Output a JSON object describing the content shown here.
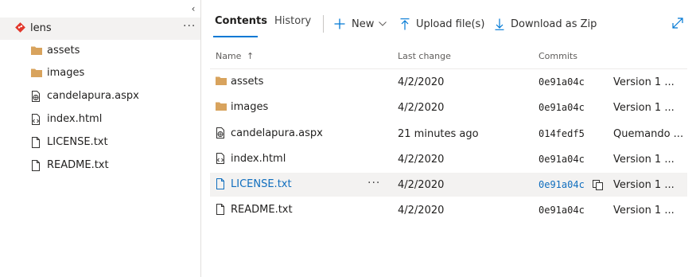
{
  "tree": {
    "collapse_glyph": "‹",
    "root": {
      "label": "lens",
      "icon": "git-repo-icon",
      "more": "···"
    },
    "items": [
      {
        "label": "assets",
        "icon": "folder-icon"
      },
      {
        "label": "images",
        "icon": "folder-icon"
      },
      {
        "label": "candelapura.aspx",
        "icon": "web-file-icon"
      },
      {
        "label": "index.html",
        "icon": "code-file-icon"
      },
      {
        "label": "LICENSE.txt",
        "icon": "file-icon"
      },
      {
        "label": "README.txt",
        "icon": "file-icon"
      }
    ]
  },
  "tabs": {
    "contents": "Contents",
    "history": "History",
    "active": "Contents"
  },
  "commands": {
    "new": "New",
    "upload": "Upload file(s)",
    "download": "Download as Zip"
  },
  "table": {
    "headers": {
      "name": "Name",
      "sort_glyph": "↑",
      "last_change": "Last change",
      "commits": "Commits"
    },
    "rows": [
      {
        "name": "assets",
        "icon": "folder-icon",
        "last_change": "4/2/2020",
        "commit": "0e91a04c",
        "message": "Version 1 ..."
      },
      {
        "name": "images",
        "icon": "folder-icon",
        "last_change": "4/2/2020",
        "commit": "0e91a04c",
        "message": "Version 1 ..."
      },
      {
        "name": "candelapura.aspx",
        "icon": "web-file-icon",
        "last_change": "21 minutes ago",
        "commit": "014fedf5",
        "message": "Quemando ..."
      },
      {
        "name": "index.html",
        "icon": "code-file-icon",
        "last_change": "4/2/2020",
        "commit": "0e91a04c",
        "message": "Version 1 ..."
      },
      {
        "name": "LICENSE.txt",
        "icon": "file-icon",
        "last_change": "4/2/2020",
        "commit": "0e91a04c",
        "message": "Version 1 ...",
        "selected": true,
        "more": "···"
      },
      {
        "name": "README.txt",
        "icon": "file-icon",
        "last_change": "4/2/2020",
        "commit": "0e91a04c",
        "message": "Version 1 ..."
      }
    ]
  },
  "colors": {
    "accent": "#0078d4",
    "link": "#106ebe",
    "git": "#e2372b",
    "folder": "#d8a35d",
    "selected_bg": "#f3f2f1"
  }
}
